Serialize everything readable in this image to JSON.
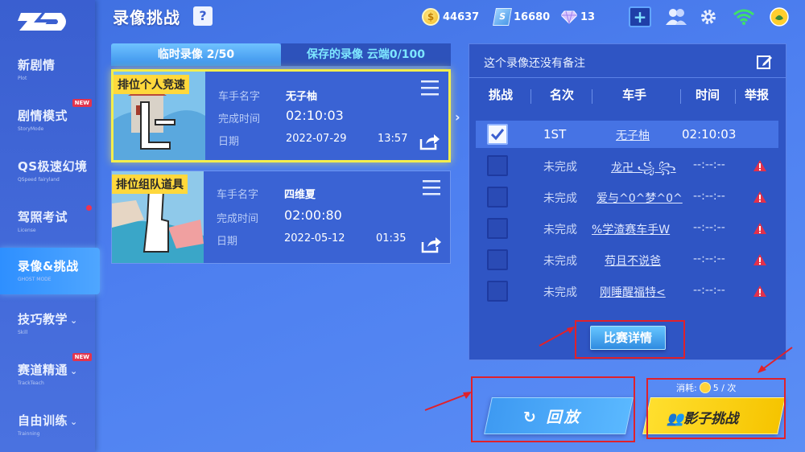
{
  "header": {
    "title": "录像挑战",
    "help_label": "?",
    "coins": "44637",
    "cards": "16680",
    "gems": "13"
  },
  "sidebar": {
    "items": [
      {
        "label": "新剧情",
        "sub": "Plot"
      },
      {
        "label": "剧情模式",
        "sub": "StoryMode",
        "badge": "NEW"
      },
      {
        "label": "QS极速幻境",
        "sub": "QSpeed fairyland"
      },
      {
        "label": "驾照考试",
        "sub": "License"
      },
      {
        "label": "录像&挑战",
        "sub": "GHOST MODE"
      },
      {
        "label": "技巧教学",
        "sub": "Skill"
      },
      {
        "label": "赛道精通",
        "sub": "TrackTeach",
        "badge": "NEW"
      },
      {
        "label": "自由训练",
        "sub": "Trainning"
      }
    ]
  },
  "tabs": {
    "temp": "临时录像 2/50",
    "saved": "保存的录像 云端0/100"
  },
  "recordings": [
    {
      "tag": "排位个人竞速",
      "racer_label": "车手名字",
      "racer": "无子柚",
      "finish_label": "完成时间",
      "finish": "02:10:03",
      "date_label": "日期",
      "date": "2022-07-29",
      "time": "13:57"
    },
    {
      "tag": "排位组队道具",
      "racer_label": "车手名字",
      "racer": "四维夏",
      "finish_label": "完成时间",
      "finish": "02:00:80",
      "date_label": "日期",
      "date": "2022-05-12",
      "time": "01:35"
    }
  ],
  "detail": {
    "note": "这个录像还没有备注",
    "columns": {
      "challenge": "挑战",
      "rank": "名次",
      "racer": "车手",
      "time": "时间",
      "report": "举报"
    },
    "rows": [
      {
        "checked": true,
        "rank": "1ST",
        "racer": "无子柚",
        "time": "02:10:03",
        "report": false
      },
      {
        "checked": false,
        "rank": "未完成",
        "racer": "龙卍 ꧁ ꧂",
        "time": "--:--:--",
        "report": true
      },
      {
        "checked": false,
        "rank": "未完成",
        "racer": "爱与^0^梦^0^",
        "time": "--:--:--",
        "report": true
      },
      {
        "checked": false,
        "rank": "未完成",
        "racer": "%学渣赛车手W",
        "time": "--:--:--",
        "report": true
      },
      {
        "checked": false,
        "rank": "未完成",
        "racer": "苟且不说爸",
        "time": "--:--:--",
        "report": true
      },
      {
        "checked": false,
        "rank": "未完成",
        "racer": "刚睡醒福特<",
        "time": "--:--:--",
        "report": true
      }
    ],
    "detail_button": "比赛详情"
  },
  "actions": {
    "replay": "回放",
    "cost_label": "消耗:",
    "cost_value": "5 / 次",
    "shadow": "影子挑战"
  },
  "colors": {
    "accent_yellow": "#ffd83c",
    "panel_blue": "#2f55c4",
    "alert_red": "#e0212b"
  }
}
